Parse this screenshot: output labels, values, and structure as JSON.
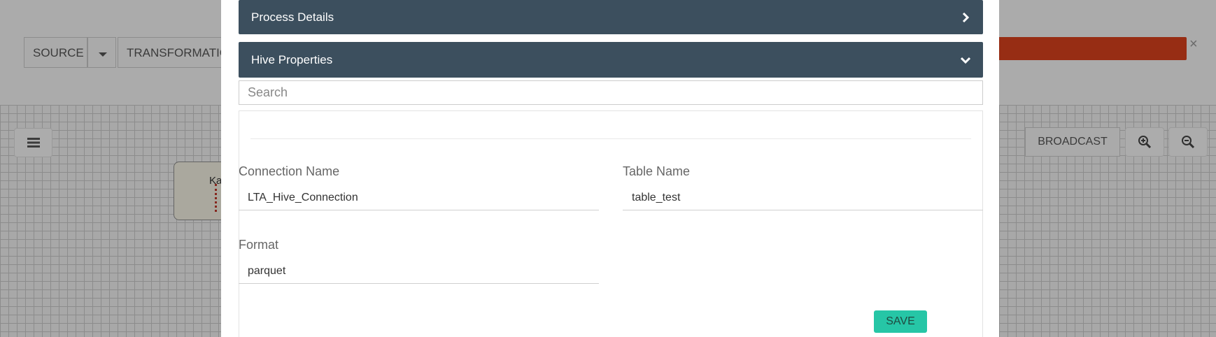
{
  "background": {
    "toolbar": {
      "source_label": "SOURCE",
      "transformation_label": "TRANSFORMATIO"
    },
    "alert": {
      "close_glyph": "×",
      "color": "#d9411e"
    },
    "canvas": {
      "node_label": "Ka",
      "broadcast_label": "BROADCAST"
    }
  },
  "modal": {
    "process_details": {
      "title": "Process Details",
      "icon": "chevron-right-icon"
    },
    "hive_properties": {
      "title": "Hive Properties",
      "icon": "chevron-down-icon"
    },
    "search": {
      "placeholder": "Search",
      "value": ""
    },
    "fields": {
      "connection_name": {
        "label": "Connection Name",
        "value": "LTA_Hive_Connection"
      },
      "table_name": {
        "label": "Table Name",
        "value": "table_test"
      },
      "format": {
        "label": "Format",
        "value": "parquet"
      }
    },
    "save_label": "SAVE"
  },
  "colors": {
    "panel_header": "#3c4f5e",
    "save_button": "#26c6a6"
  }
}
